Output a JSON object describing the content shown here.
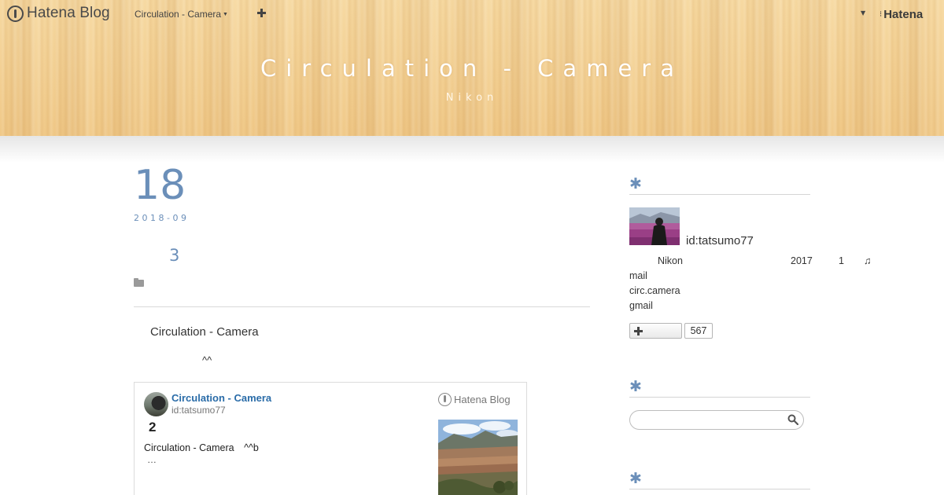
{
  "globalbar": {
    "logo_text": "Hatena Blog",
    "blog_menu_label": "Circulation - Camera",
    "add_label": "+",
    "brand_text": "Hatena"
  },
  "header": {
    "title": "Circulation - Camera",
    "description": "Nikon"
  },
  "entry": {
    "date_day": "18",
    "date_ym": "2018-09",
    "title": "3",
    "body_line1": "Circulation - Camera",
    "body_line2": "^^"
  },
  "embed_card": {
    "blog_title": "Circulation - Camera",
    "user_id": "id:tatsumo77",
    "logo_text": "Hatena Blog",
    "heading": "2",
    "excerpt": "Circulation - Camera　^^b",
    "ellipsis": "…"
  },
  "sidebar": {
    "profile": {
      "heading_symbol": "✱",
      "user_id": "id:tatsumo77",
      "line": {
        "camera": "Nikon",
        "year": "2017",
        "count": "1",
        "note": "♫"
      },
      "contact": [
        "mail",
        "circ.camera",
        "gmail"
      ],
      "follow_label": "+",
      "follow_count": "567"
    },
    "search": {
      "heading_symbol": "✱",
      "placeholder": ""
    },
    "third": {
      "heading_symbol": "✱"
    }
  },
  "colors": {
    "accent": "#6b8fb9",
    "link": "#2a6ca8",
    "header_wood": "#f3cf8f"
  },
  "icons": {
    "logo": "hatena-pen-icon",
    "folder": "folder-icon",
    "search": "search-icon",
    "follow": "plus-icon"
  }
}
